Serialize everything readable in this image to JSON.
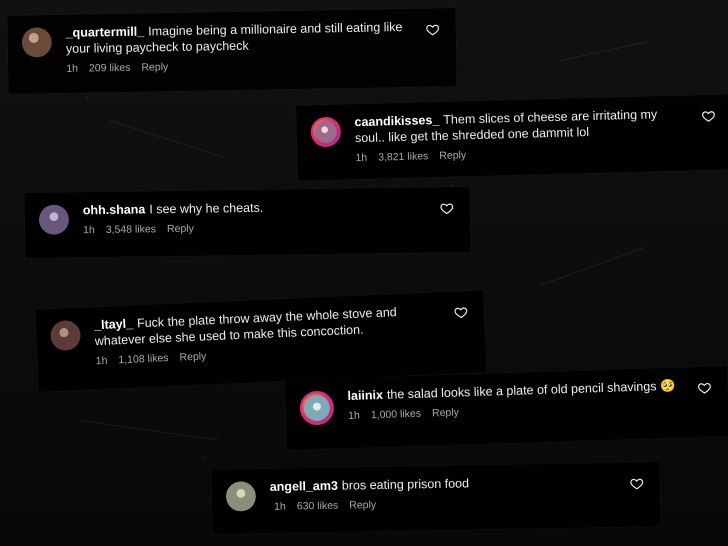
{
  "comments": [
    {
      "username": "_quartermill_",
      "text": "Imagine being a millionaire and still eating like your living paycheck to paycheck",
      "time": "1h",
      "likes": "209 likes",
      "reply": "Reply",
      "avatar_color": "#6b4a3a"
    },
    {
      "username": "caandikisses_",
      "text": "Them slices of cheese are irritating my soul.. like get the shredded one dammit lol",
      "time": "1h",
      "likes": "3,821 likes",
      "reply": "Reply",
      "avatar_color": "#9a6c8a"
    },
    {
      "username": "ohh.shana",
      "text": "I see why he cheats.",
      "time": "1h",
      "likes": "3,548 likes",
      "reply": "Reply",
      "avatar_color": "#6a577e"
    },
    {
      "username": "_ltayl_",
      "text": "Fuck the plate throw away the whole stove and whatever else she used to make this concoction.",
      "time": "1h",
      "likes": "1,108 likes",
      "reply": "Reply",
      "avatar_color": "#5c3b38"
    },
    {
      "username": "laiinix",
      "text": "the salad looks like a plate of old pencil shavings 🥺",
      "time": "1h",
      "likes": "1,000 likes",
      "reply": "Reply",
      "avatar_color": "#7fa9b3"
    },
    {
      "username": "angell_am3",
      "text": "bros eating prison food",
      "time": "1h",
      "likes": "630 likes",
      "reply": "Reply",
      "avatar_color": "#8a8f78"
    }
  ],
  "icons": {
    "like": "heart-icon"
  }
}
